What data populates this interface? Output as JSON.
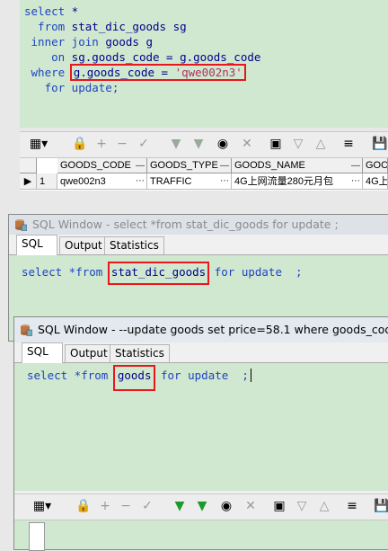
{
  "top_query": {
    "lines": [
      {
        "kw": "select",
        "rest": " *"
      },
      {
        "kw": "  from",
        "rest": " stat_dic_goods sg"
      },
      {
        "kw": " inner join",
        "rest": " goods g"
      },
      {
        "kw": "    on",
        "rest": " sg.goods_code = g.goods_code"
      }
    ],
    "where_kw": " where",
    "where_cond_lhs": "g.goods_code = ",
    "where_cond_str": "'qwe002n3'",
    "for_update": "   for update;"
  },
  "result_grid": {
    "columns": [
      "GOODS_CODE",
      "GOODS_TYPE",
      "GOODS_NAME",
      "GOC"
    ],
    "rows": [
      {
        "num": "1",
        "goods_code": "qwe002n3",
        "goods_type": "TRAFFIC",
        "goods_name": "4G上网流量280元月包",
        "extra": "4G上"
      }
    ]
  },
  "window1": {
    "title": "SQL Window - select *from stat_dic_goods for update ;",
    "tabs": [
      "SQL",
      "Output",
      "Statistics"
    ],
    "sql_pre": "select *from ",
    "sql_table": "stat_dic_goods",
    "sql_post": " for update  ;"
  },
  "window2": {
    "title": "SQL Window - --update goods set price=58.1 where goods_code",
    "tabs": [
      "SQL",
      "Output",
      "Statistics"
    ],
    "sql_pre": "select *from ",
    "sql_table": "goods",
    "sql_post": " for update  ;"
  },
  "colors": {
    "editor_bg": "#cfe8cf",
    "keyword": "#1f43c4",
    "highlight_box": "#e8171d"
  }
}
